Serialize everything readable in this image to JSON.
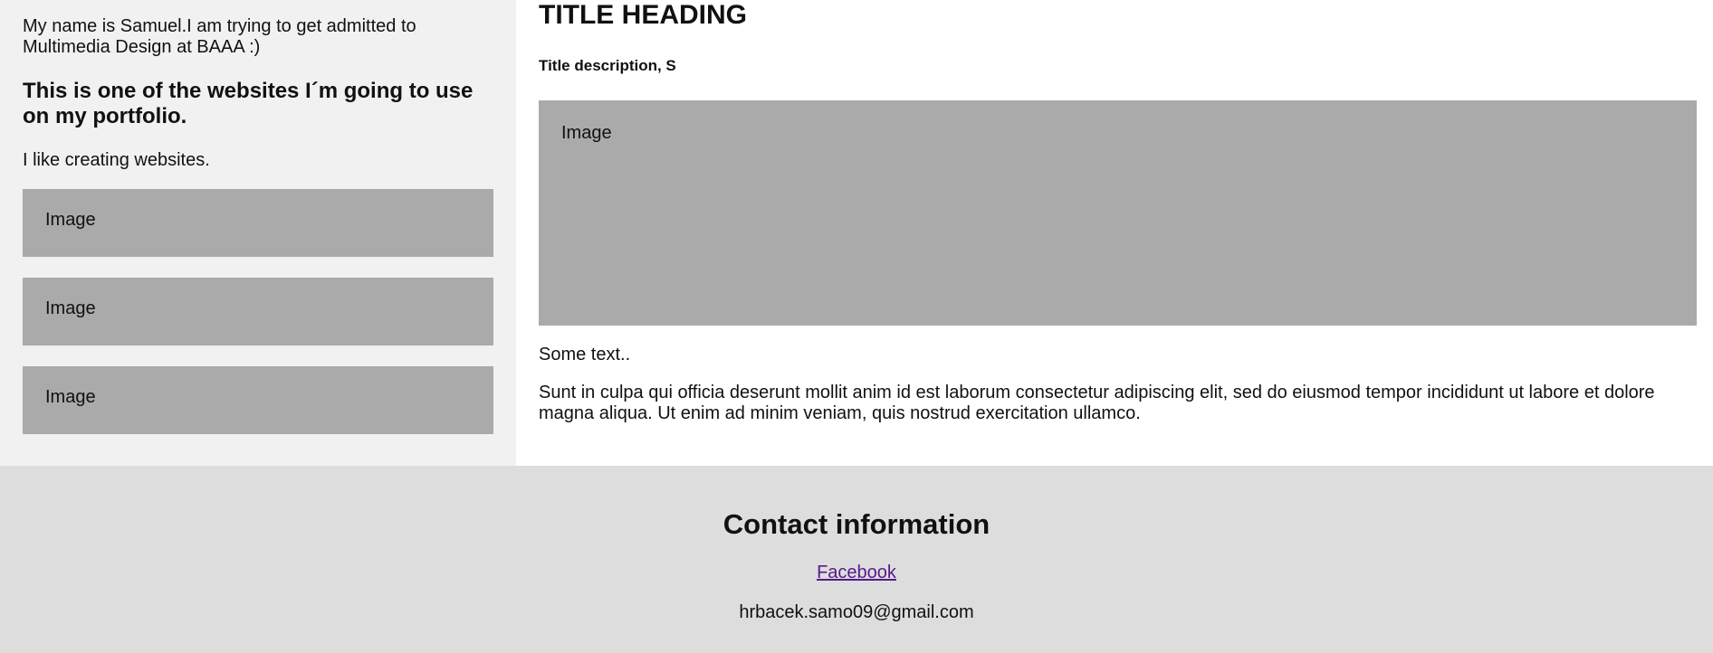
{
  "sidebar": {
    "intro": "My name is Samuel.I am trying to get admitted to Multimedia Design at BAAA :)",
    "portfolio_heading": "This is one of the websites I´m going to use on my portfolio.",
    "like_text": "I like creating websites.",
    "images": [
      {
        "label": "Image"
      },
      {
        "label": "Image"
      },
      {
        "label": "Image"
      }
    ]
  },
  "main": {
    "title": "TITLE HEADING",
    "description": "Title description, S",
    "image_label": "Image",
    "some_text": "Some text..",
    "paragraph": "Sunt in culpa qui officia deserunt mollit anim id est laborum consectetur adipiscing elit, sed do eiusmod tempor incididunt ut labore et dolore magna aliqua. Ut enim ad minim veniam, quis nostrud exercitation ullamco."
  },
  "footer": {
    "heading": "Contact information",
    "facebook_label": "Facebook",
    "email": "hrbacek.samo09@gmail.com"
  },
  "colors": {
    "sidebar_background": "#f1f1f1",
    "image_placeholder": "#aaaaaa",
    "footer_background": "#dddddd",
    "visited_link": "#551a8b"
  }
}
